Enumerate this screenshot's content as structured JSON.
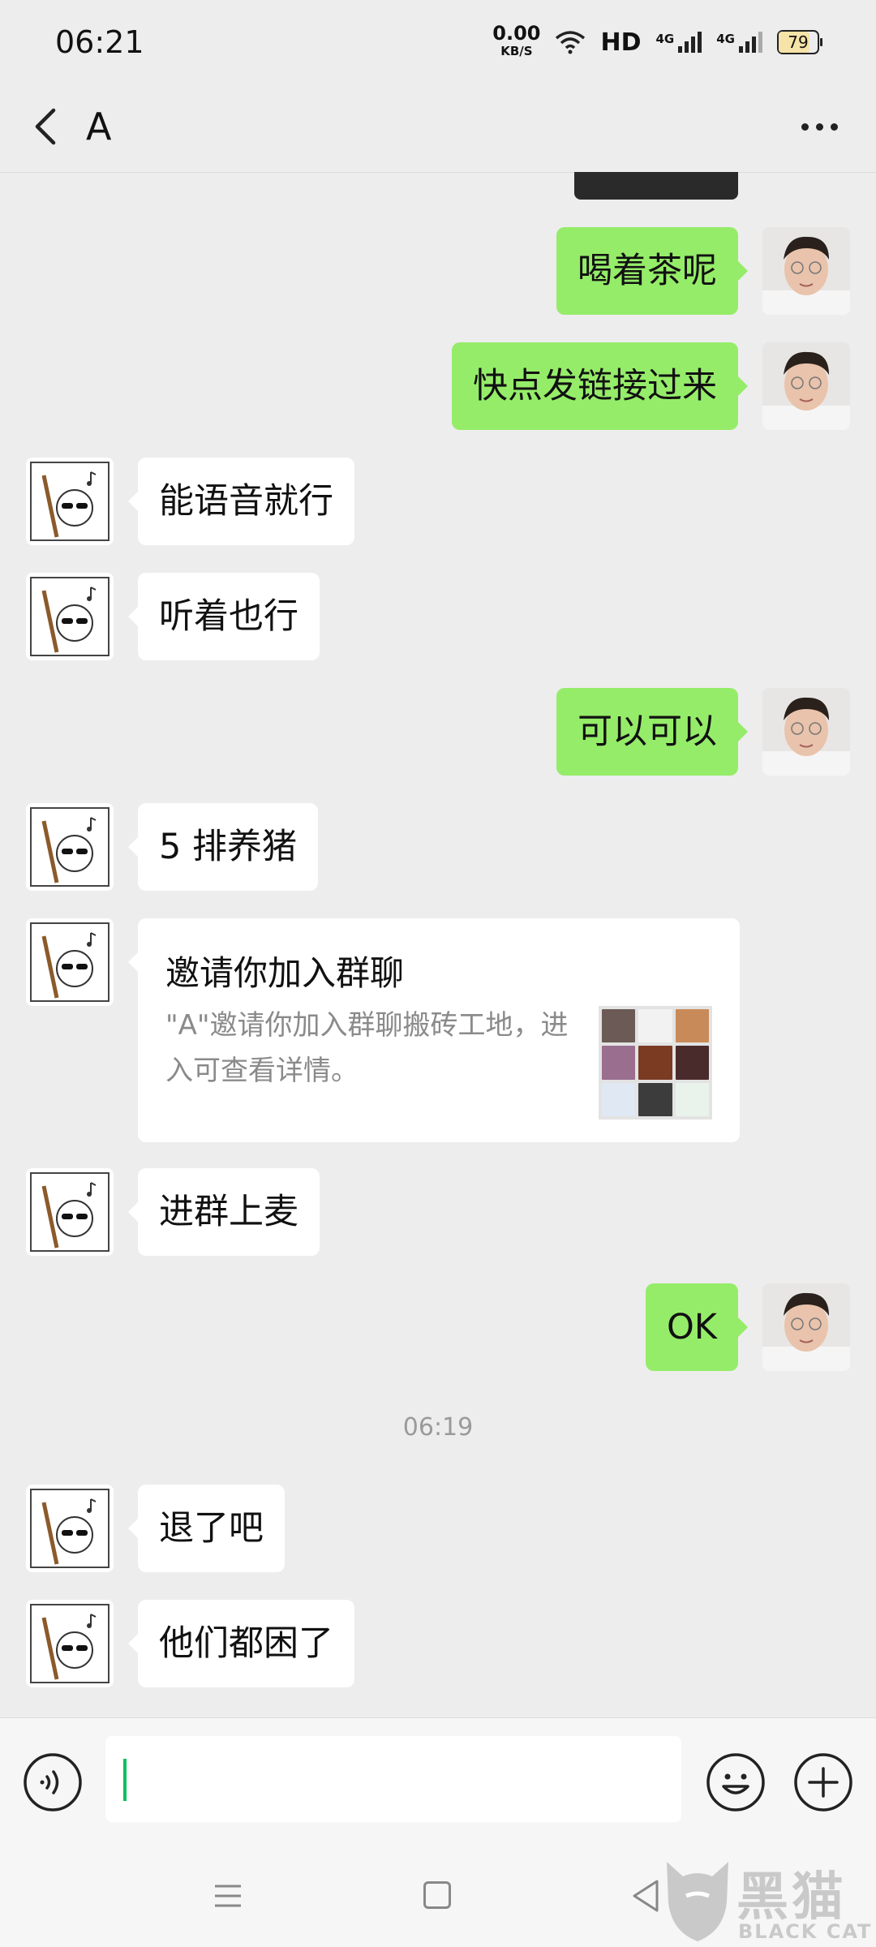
{
  "status_bar": {
    "time": "06:21",
    "net_speed_value": "0.00",
    "net_speed_unit": "KB/S",
    "hd_label": "HD",
    "sim1_label": "4G",
    "sim2_label": "4G",
    "battery_level": "79"
  },
  "header": {
    "title": "A",
    "back_icon": "chevron-left-icon",
    "more_icon": "more-horizontal-icon"
  },
  "messages": [
    {
      "side": "out",
      "text": "喝着茶呢"
    },
    {
      "side": "out",
      "text": "快点发链接过来"
    },
    {
      "side": "in",
      "text": "能语音就行"
    },
    {
      "side": "in",
      "text": "听着也行"
    },
    {
      "side": "out",
      "text": "可以可以"
    },
    {
      "side": "in",
      "text": "5 排养猪"
    },
    {
      "side": "in",
      "type": "card",
      "card_title": "邀请你加入群聊",
      "card_desc": "\"A\"邀请你加入群聊搬砖工地，进入可查看详情。"
    },
    {
      "side": "in",
      "text": "进群上麦"
    },
    {
      "side": "out",
      "text": "OK"
    },
    {
      "side": "in",
      "text": "退了吧"
    },
    {
      "side": "in",
      "text": "他们都困了"
    }
  ],
  "timestamp": "06:19",
  "input_bar": {
    "voice_icon": "voice-icon",
    "emoji_icon": "emoji-icon",
    "plus_icon": "plus-icon"
  },
  "watermark": {
    "text": "黑猫",
    "sub": "BLACK CAT"
  },
  "colors": {
    "background": "#ededed",
    "bubble_out": "#95ec69",
    "bubble_in": "#ffffff",
    "cursor": "#07c160"
  }
}
